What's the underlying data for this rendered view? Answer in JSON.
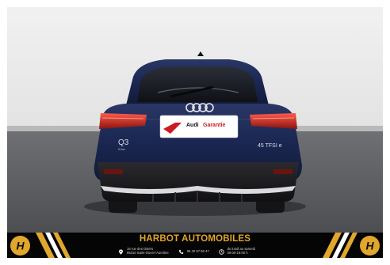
{
  "vehicle": {
    "brand": "Audi",
    "model_badge": "Q3",
    "model_sub": "S line",
    "engine_badge": "45 TFSI e",
    "plate_text": "Garantie"
  },
  "banner": {
    "dealer_name": "HARBOT AUTOMOBILES",
    "address_line1": "16 rue des Osiers",
    "address_line2": "95310 Saint-Ouen-l'Aumône",
    "phone": "06 40 97 58 47",
    "hours_line1": "du lundi au samedi",
    "hours_line2": "09:00-19:00 h",
    "logo_letter": "H"
  },
  "colors": {
    "car_body": "#1b2752",
    "banner_accent": "#e1a62d",
    "studio_wall": "#ececec",
    "floor": "#5a5c60"
  }
}
